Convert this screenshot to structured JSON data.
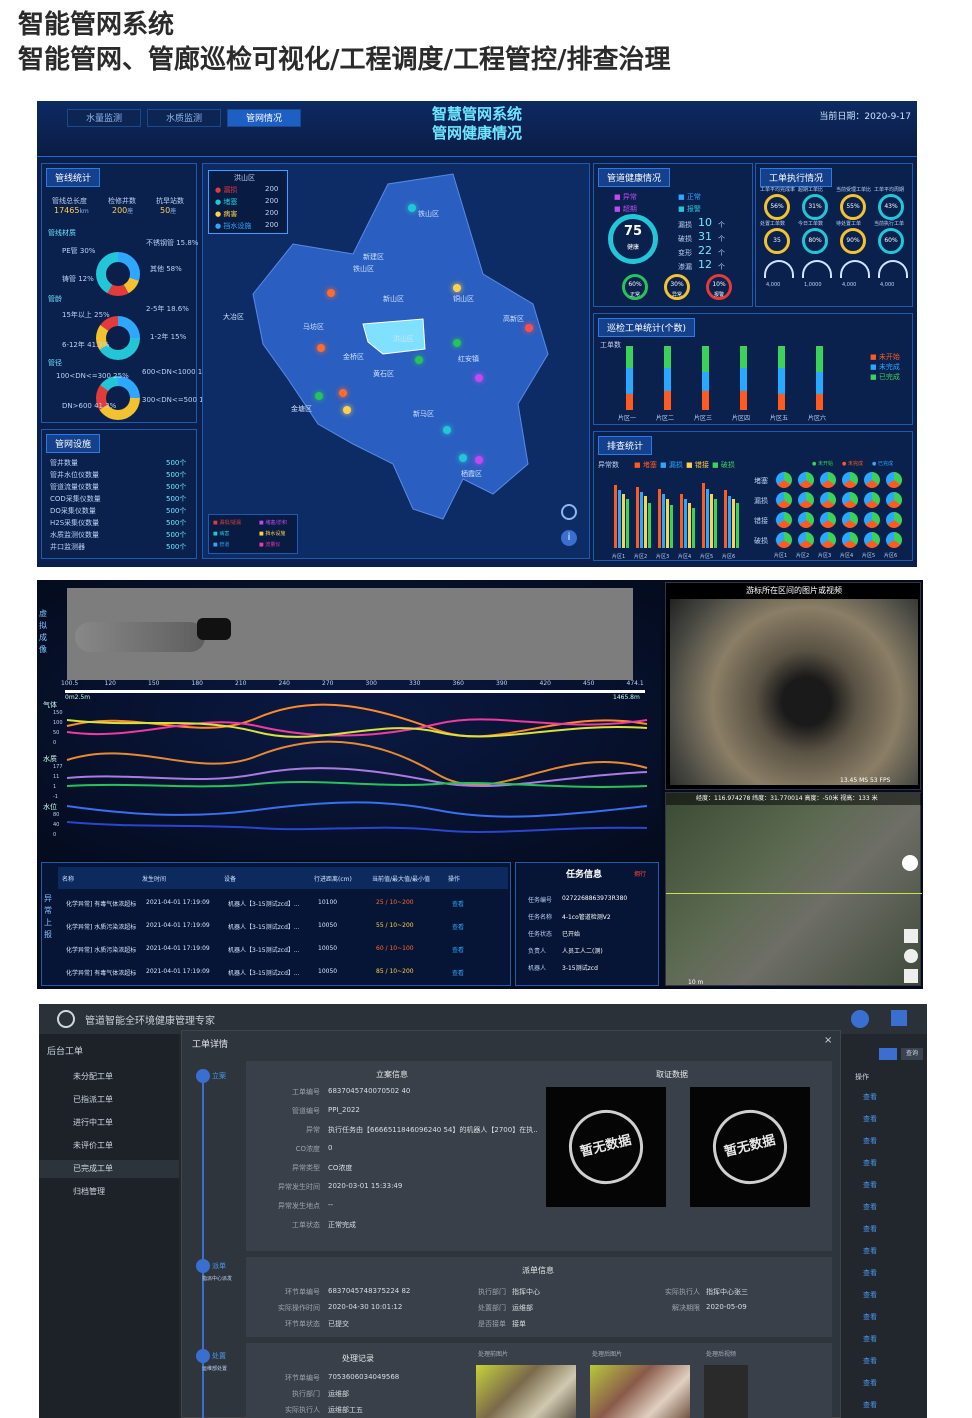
{
  "header": {
    "title": "智能管网系统",
    "subtitle": "智能管网、管廊巡检可视化/工程调度/工程管控/排查治理"
  },
  "dash": {
    "tabs": [
      "水量监测",
      "水质监测",
      "管网情况"
    ],
    "title1": "智慧管网系统",
    "title2": "管网健康情况",
    "date": "当前日期：2020-9-17",
    "pipe_stats": {
      "title": "管线统计",
      "len_label": "管线总长度",
      "len_val": "17465",
      "len_unit": "km",
      "well_label": "检修井数",
      "well_val": "200",
      "well_unit": "座",
      "plant_label": "抗旱站数",
      "plant_val": "50",
      "plant_unit": "座",
      "material": {
        "title": "管线材质",
        "items": [
          "PE管 30%",
          "铸管 12%",
          "不锈钢管 15.8%",
          "其他 58%"
        ]
      },
      "age": {
        "title": "管龄",
        "items": [
          "15年以上 25%",
          "6-12年 41.3%",
          "2-5年 18.6%",
          "1-2年 15%"
        ]
      },
      "dia": {
        "title": "管径",
        "items": [
          "100<DN<=300 25%",
          "DN>600 41.3%",
          "600<DN<1000 18.6%",
          "300<DN<=500 15%"
        ]
      }
    },
    "facilities": {
      "title": "管网设施",
      "rows": [
        [
          "管井数量",
          "500个"
        ],
        [
          "管井水位仪数量",
          "500个"
        ],
        [
          "管道流量仪数量",
          "500个"
        ],
        [
          "COD采集仪数量",
          "500个"
        ],
        [
          "DO采集仪数量",
          "500个"
        ],
        [
          "H2S采集仪数量",
          "500个"
        ],
        [
          "水质监测仪数量",
          "500个"
        ],
        [
          "井口监测器",
          "500个"
        ]
      ]
    },
    "map": {
      "legend_title": "洪山区",
      "legend": [
        [
          "漏损",
          "200"
        ],
        [
          "堵塞",
          "200"
        ],
        [
          "病害",
          "200"
        ],
        [
          "挡水设施",
          "200"
        ]
      ],
      "districts": [
        "铁山区",
        "新建区",
        "铁山区",
        "新山区",
        "铜山区",
        "高新区",
        "大冶区",
        "马坊区",
        "洪山区",
        "金桥区",
        "黄石区",
        "红安镇",
        "新马区",
        "栖霞区",
        "金塘区"
      ],
      "bottom_legend": [
        "漏损/疑漏",
        "堵塞/淤积",
        "病害",
        "挡水设施",
        "管道",
        "流量仪"
      ]
    },
    "health": {
      "title": "管道健康情况",
      "score": "75",
      "score_label": "健康",
      "legend": [
        "异常",
        "正常",
        "超期",
        "报警"
      ],
      "counts": [
        [
          "漏损",
          "10",
          "个"
        ],
        [
          "破损",
          "31",
          "个"
        ],
        [
          "变形",
          "22",
          "个"
        ],
        [
          "渗漏",
          "12",
          "个"
        ]
      ],
      "rings": [
        [
          "60%",
          "正常"
        ],
        [
          "30%",
          "异常"
        ],
        [
          "10%",
          "报警"
        ]
      ]
    },
    "work": {
      "title": "工单执行情况",
      "rings": [
        [
          "工单平均完成率",
          "56%"
        ],
        [
          "超期工单比",
          "31%"
        ],
        [
          "当前受理工单比",
          "55%"
        ],
        [
          "工单平均周期",
          "43%"
        ],
        [
          "处置工单数",
          "35"
        ],
        [
          "今日工单数",
          "80%"
        ],
        [
          "待处置工单",
          "90%"
        ],
        [
          "当前执行工单",
          "60%"
        ]
      ],
      "gauges": [
        "4,000",
        "1,0000",
        "4,000",
        "4,000"
      ]
    },
    "patrol": {
      "title": "巡检工单统计(个数)",
      "y_label": "工单数",
      "cats": [
        "片区一",
        "片区二",
        "片区三",
        "片区四",
        "片区五",
        "片区六"
      ],
      "legend": [
        "未开始",
        "未完成",
        "已完成"
      ],
      "series": [
        [
          0.25,
          0.3,
          0.3,
          0.3,
          0.25,
          0.25
        ],
        [
          0.4,
          0.35,
          0.3,
          0.35,
          0.4,
          0.35
        ],
        [
          0.35,
          0.35,
          0.4,
          0.35,
          0.35,
          0.4
        ]
      ]
    },
    "check": {
      "title": "排查统计",
      "y_label": "异常数",
      "legend": [
        "堵塞",
        "漏损",
        "错接",
        "破损"
      ],
      "cats": [
        "片区1",
        "片区2",
        "片区3",
        "片区4",
        "片区5",
        "片区6"
      ],
      "pie_legend": [
        "未开始",
        "未完成",
        "已完成"
      ],
      "pie_rows": [
        "堵塞",
        "漏损",
        "错接",
        "破损"
      ],
      "pie_cols": [
        "片区1",
        "片区2",
        "片区3",
        "片区4",
        "片区5",
        "片区6"
      ],
      "values": [
        [
          70,
          65,
          60,
          55
        ],
        [
          68,
          62,
          58,
          50
        ],
        [
          66,
          60,
          55,
          48
        ],
        [
          60,
          55,
          50,
          45
        ],
        [
          72,
          66,
          60,
          55
        ],
        [
          64,
          58,
          54,
          50
        ]
      ]
    }
  },
  "robot": {
    "virtual_label": "虚拟成像",
    "y_ticks": [
      "60",
      "50",
      "40",
      "30",
      "20",
      "10",
      "0"
    ],
    "x_ticks": [
      "100.5",
      "120",
      "150",
      "180",
      "210",
      "240",
      "270",
      "300",
      "330",
      "360",
      "390",
      "420",
      "450",
      "474.1"
    ],
    "unit_m": "m",
    "total": "1465.8m",
    "left": "0m2.5m",
    "ch": [
      {
        "name": "气体",
        "ticks": [
          "150",
          "100",
          "50",
          "0"
        ]
      },
      {
        "name": "水质",
        "ticks": [
          "177",
          "11",
          "1",
          "-1"
        ]
      },
      {
        "name": "水位",
        "ticks": [
          "80",
          "40",
          "0"
        ]
      }
    ],
    "table": {
      "side_label": "异常上报",
      "headers": [
        "名称",
        "发生时间",
        "设备",
        "行进距离(cm)",
        "当前值/最大值/最小值",
        "操作"
      ],
      "rows": [
        [
          "化学异常] 有毒气体浓超标",
          "2021-04-01 17:19:09",
          "机器人【3-15测试zcd】...",
          "10100",
          "25 / 10~200",
          "查看"
        ],
        [
          "化学异常] 水质污染浓超标",
          "2021-04-01 17:19:09",
          "机器人【3-15测试zcd】...",
          "10050",
          "55 / 10~200",
          "查看"
        ],
        [
          "化学异常] 水质污染浓超标",
          "2021-04-01 17:19:09",
          "机器人【3-15测试zcd】...",
          "10050",
          "60 / 10~100",
          "查看"
        ],
        [
          "化学异常] 有毒气体浓超标",
          "2021-04-01 17:19:09",
          "机器人【3-15测试zcd】...",
          "10050",
          "85 / 10~200",
          "查看"
        ]
      ]
    },
    "task": {
      "title": "任务信息",
      "tag": "拥行",
      "rows": [
        [
          "任务编号",
          "0272268863973R380"
        ],
        [
          "任务名称",
          "4-1co管道检测V2"
        ],
        [
          "任务状态",
          "已开始"
        ],
        [
          "负责人",
          "人员工人二(测)"
        ],
        [
          "机器人",
          "3-15测试zcd"
        ]
      ]
    },
    "video_title": "游标所在区间的图片或视频",
    "video_stats": "13.45 MS   53 FPS",
    "map_coords": "经度：116.974278   纬度：31.770014   高度：-50米   视高：133 米",
    "scale": "10 m"
  },
  "workorder": {
    "app_title": "管道智能全环境健康管理专家",
    "menu_title": "后台工单",
    "menu": [
      "未分配工单",
      "已指派工单",
      "进行中工单",
      "未评价工单",
      "已完成工单",
      "归档管理"
    ],
    "modal_title": "工单详情",
    "steps": [
      [
        "立案",
        ""
      ],
      [
        "派单",
        "指派中心派发"
      ],
      [
        "处置",
        "运维部处置"
      ]
    ],
    "reg": {
      "title": "立案信息",
      "rows": [
        [
          "工单编号",
          "6837045740070502 40"
        ],
        [
          "管道编号",
          "PPI_2022"
        ],
        [
          "异常",
          "执行任务由【6666511846096240 54】的机器人【2700】在执..."
        ],
        [
          "CO浓度",
          "0"
        ],
        [
          "异常类型",
          "CO浓度"
        ],
        [
          "异常发生时间",
          "2020-03-01 15:33:49"
        ],
        [
          "异常发生地点",
          "--"
        ],
        [
          "工单状态",
          "正常完成"
        ]
      ]
    },
    "evidence": {
      "title": "取证数据",
      "nodata": "暂无数据"
    },
    "dispatch": {
      "title": "派单信息",
      "rows": [
        [
          "环节单编号",
          "6837045748375224 82"
        ],
        [
          "实际操作时间",
          "2020-04-30 10:01:12"
        ],
        [
          "环节单状态",
          "已提交"
        ]
      ],
      "rows2": [
        [
          "执行部门",
          "指挥中心"
        ],
        [
          "处置部门",
          "运维部"
        ],
        [
          "是否接单",
          "接单"
        ]
      ],
      "rows3": [
        [
          "实际执行人",
          "指挥中心张三"
        ],
        [
          "解决期限",
          "2020-05-09"
        ]
      ]
    },
    "handle": {
      "title": "处理记录",
      "rows": [
        [
          "环节单编号",
          "7053606034049568"
        ],
        [
          "执行部门",
          "运维部"
        ],
        [
          "实际执行人",
          "运维部工五"
        ]
      ],
      "img_labels": [
        "处理前图片",
        "处理后图片",
        "处理后视频"
      ]
    },
    "right_tabs": [
      "",
      "查询"
    ],
    "col_label": "操作",
    "col_items": [
      "查看",
      "查看",
      "查看",
      "查看",
      "查看",
      "查看",
      "查看",
      "查看",
      "查看",
      "查看",
      "查看",
      "查看",
      "查看",
      "查看",
      "查看"
    ]
  }
}
